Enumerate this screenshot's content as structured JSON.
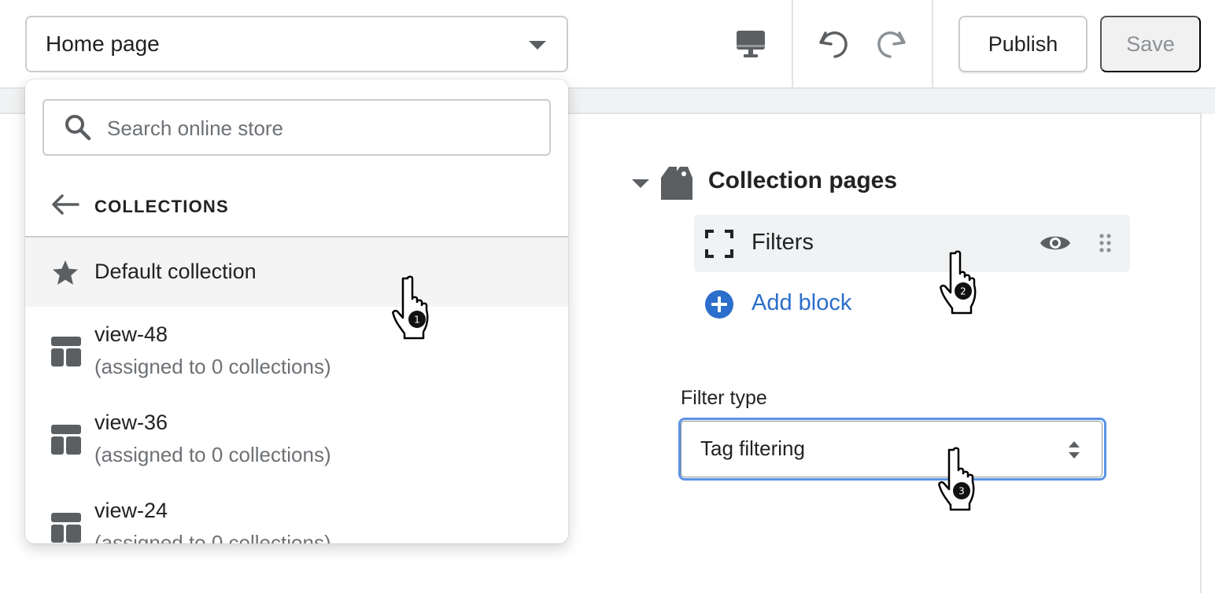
{
  "topbar": {
    "page_select_value": "Home page",
    "publish_label": "Publish",
    "save_label": "Save",
    "icons": [
      "desktop-icon",
      "undo-icon",
      "redo-icon",
      "chevron-down-icon"
    ]
  },
  "dropdown": {
    "search_placeholder": "Search online store",
    "back_label": "COLLECTIONS",
    "items": [
      {
        "label": "Default collection",
        "icon": "star-icon",
        "highlighted": true
      },
      {
        "label": "view-48",
        "sub": "(assigned to 0 collections)",
        "icon": "template-icon"
      },
      {
        "label": "view-36",
        "sub": "(assigned to 0 collections)",
        "icon": "template-icon"
      },
      {
        "label": "view-24",
        "sub": "(assigned to 0 collections)",
        "icon": "template-icon"
      }
    ]
  },
  "panel": {
    "section_title": "Collection pages",
    "block_label": "Filters",
    "add_block_label": "Add block",
    "filter_type_label": "Filter type",
    "filter_type_value": "Tag filtering"
  },
  "cursors": [
    {
      "step": "1"
    },
    {
      "step": "2"
    },
    {
      "step": "3"
    }
  ],
  "colors": {
    "accent_blue": "#2c6ecb",
    "focus_ring": "#5b93e4",
    "border": "#c9cccf",
    "icon_gray": "#5c5f62",
    "save_disabled_bg": "#f1f1f1"
  }
}
